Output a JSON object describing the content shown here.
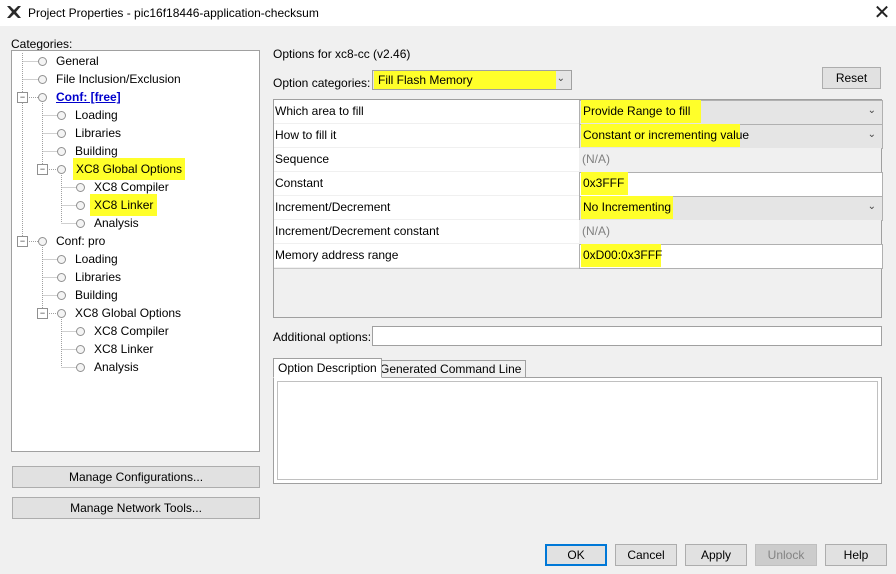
{
  "window": {
    "title": "Project Properties - pic16f18446-application-checksum",
    "close_glyph": "✕",
    "app_icon": "mplab-x-icon"
  },
  "categories": {
    "label": "Categories:",
    "expander_glyph": "−",
    "nodes": [
      {
        "label": "General"
      },
      {
        "label": "File Inclusion/Exclusion"
      },
      {
        "label": "Conf: [free]"
      },
      {
        "label": "Loading"
      },
      {
        "label": "Libraries"
      },
      {
        "label": "Building"
      },
      {
        "label": "XC8 Global Options"
      },
      {
        "label": "XC8 Compiler"
      },
      {
        "label": "XC8 Linker"
      },
      {
        "label": "Analysis"
      },
      {
        "label": "Conf: pro"
      },
      {
        "label": "Loading"
      },
      {
        "label": "Libraries"
      },
      {
        "label": "Building"
      },
      {
        "label": "XC8 Global Options"
      },
      {
        "label": "XC8 Compiler"
      },
      {
        "label": "XC8 Linker"
      },
      {
        "label": "Analysis"
      }
    ]
  },
  "left_buttons": {
    "manage_configs": "Manage Configurations...",
    "manage_network": "Manage Network Tools..."
  },
  "options": {
    "options_for": "Options for xc8-cc (v2.46)",
    "category_label": "Option categories:",
    "category_value": "Fill Flash Memory",
    "reset": "Reset",
    "dropdown_glyph": "⌄",
    "rows": [
      {
        "name": "Which area to fill",
        "value": "Provide Range to fill"
      },
      {
        "name": "How to fill it",
        "value": "Constant or incrementing value"
      },
      {
        "name": "Sequence",
        "value": "(N/A)"
      },
      {
        "name": "Constant",
        "value": "0x3FFF"
      },
      {
        "name": "Increment/Decrement",
        "value": "No Incrementing"
      },
      {
        "name": "Increment/Decrement constant",
        "value": "(N/A)"
      },
      {
        "name": "Memory address range",
        "value": "0xD00:0x3FFF"
      }
    ],
    "additional_label": "Additional options:",
    "additional_value": ""
  },
  "tabs": {
    "description": "Option Description",
    "command_line": "Generated Command Line"
  },
  "footer": {
    "ok": "OK",
    "cancel": "Cancel",
    "apply": "Apply",
    "unlock": "Unlock",
    "help": "Help"
  },
  "colors": {
    "highlight": "#ffff2a",
    "link": "#0000cc",
    "default_button_border": "#0078d7"
  }
}
